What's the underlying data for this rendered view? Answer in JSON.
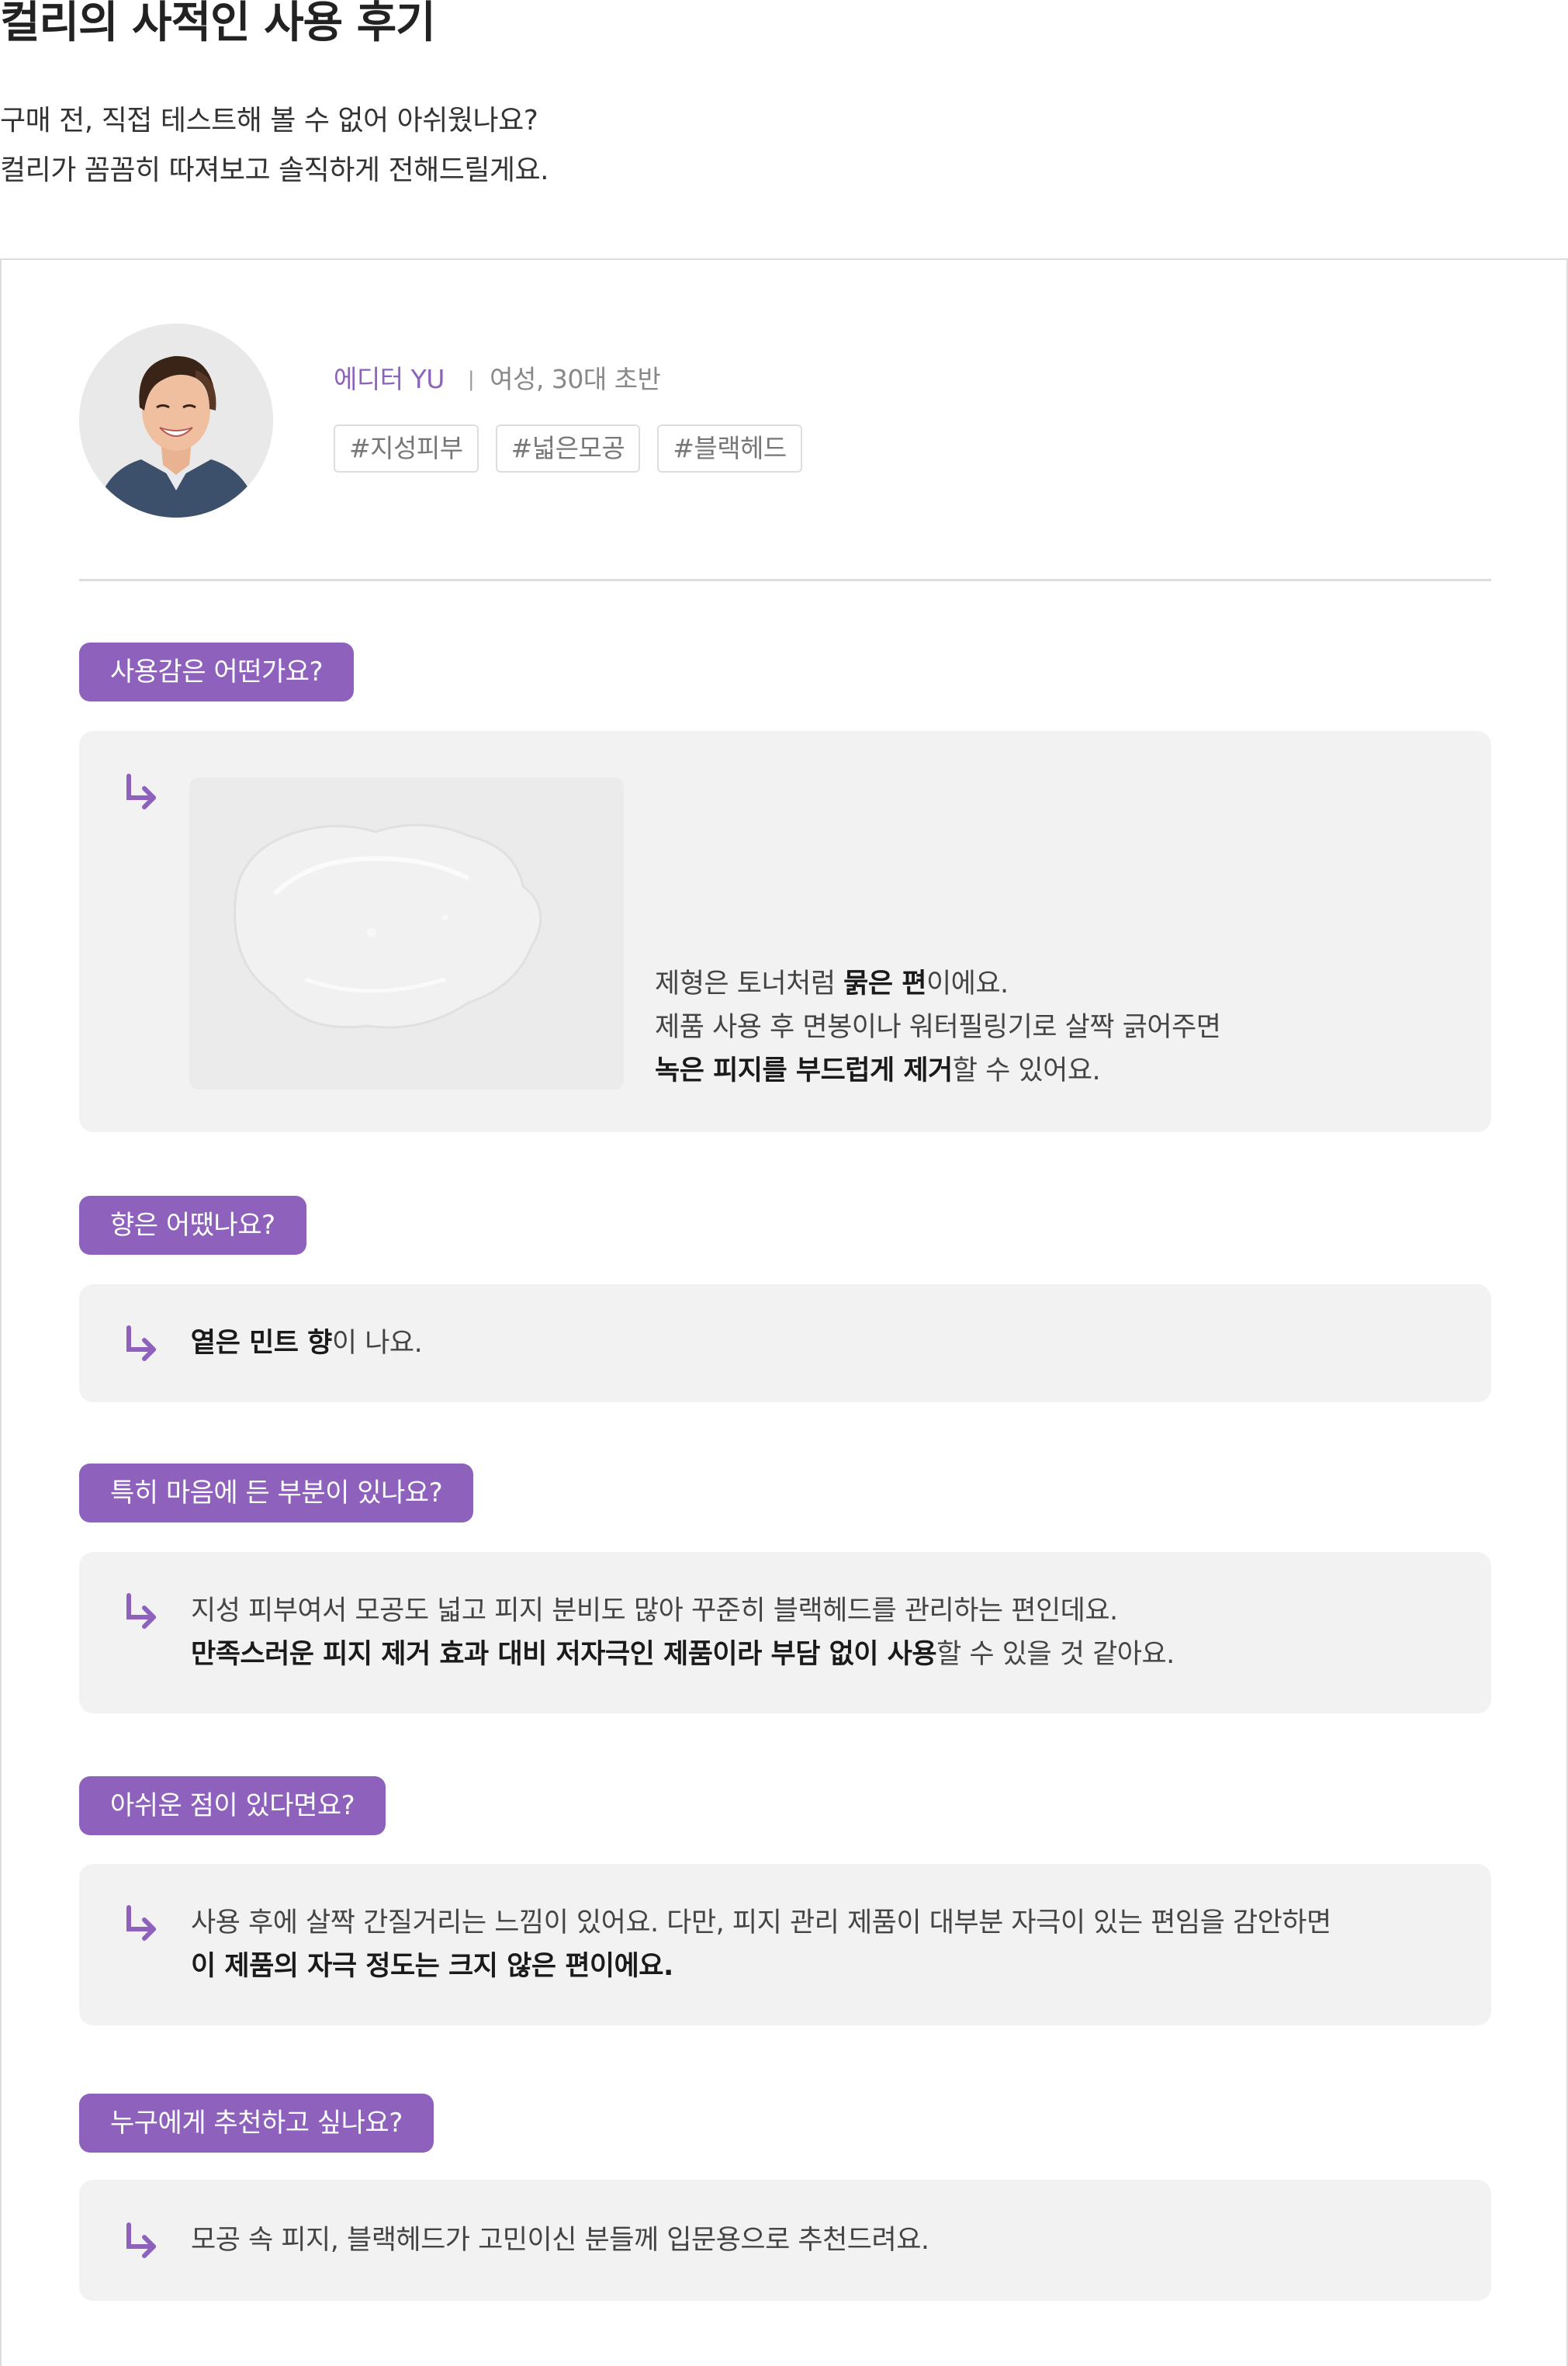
{
  "header": {
    "title": "컬리의 사적인 사용 후기",
    "intro_line1": "구매 전, 직접 테스트해 볼 수 없어 아쉬웠나요?",
    "intro_line2": "컬리가 꼼꼼히 따져보고 솔직하게 전해드릴게요."
  },
  "editor": {
    "name": "에디터 YU",
    "separator": "|",
    "info": "여성, 30대 초반",
    "tags": [
      "#지성피부",
      "#넓은모공",
      "#블랙헤드"
    ]
  },
  "colors": {
    "accent": "#8e62bc",
    "answer_bg": "#f2f2f2",
    "border": "#dddddd"
  },
  "qa": [
    {
      "question": "사용감은 어떤가요?",
      "lines": [
        [
          {
            "t": "제형은 토너처럼 ",
            "b": false
          },
          {
            "t": "묽은 편",
            "b": true
          },
          {
            "t": "이에요.",
            "b": false
          }
        ],
        [
          {
            "t": "제품 사용 후 면봉이나 워터필링기로 살짝 긁어주면",
            "b": false
          }
        ],
        [
          {
            "t": "녹은 피지를 부드럽게 제거",
            "b": true
          },
          {
            "t": "할 수 있어요.",
            "b": false
          }
        ]
      ]
    },
    {
      "question": "향은 어땠나요?",
      "lines": [
        [
          {
            "t": "옅은 민트 향",
            "b": true
          },
          {
            "t": "이 나요.",
            "b": false
          }
        ]
      ]
    },
    {
      "question": "특히 마음에 든 부분이 있나요?",
      "lines": [
        [
          {
            "t": "지성 피부여서 모공도 넓고 피지 분비도 많아 꾸준히 블랙헤드를 관리하는 편인데요.",
            "b": false
          }
        ],
        [
          {
            "t": "만족스러운 피지 제거 효과 대비 저자극인 제품이라 부담 없이 사용",
            "b": true
          },
          {
            "t": "할 수 있을 것 같아요.",
            "b": false
          }
        ]
      ]
    },
    {
      "question": "아쉬운 점이 있다면요?",
      "lines": [
        [
          {
            "t": "사용 후에 살짝 간질거리는 느낌이 있어요. 다만, 피지 관리 제품이 대부분 자극이 있는 편임을 감안하면",
            "b": false
          }
        ],
        [
          {
            "t": "이 제품의 자극 정도는 크지 않은 편이에요.",
            "b": true
          }
        ]
      ]
    },
    {
      "question": "누구에게 추천하고 싶나요?",
      "lines": [
        [
          {
            "t": "모공 속 피지, 블랙헤드가 고민이신 분들께 입문용으로 추천드려요.",
            "b": false
          }
        ]
      ]
    }
  ],
  "icons": {
    "answer_arrow": "arrow-down-right-icon",
    "avatar": "editor-avatar",
    "texture": "product-texture-image"
  }
}
